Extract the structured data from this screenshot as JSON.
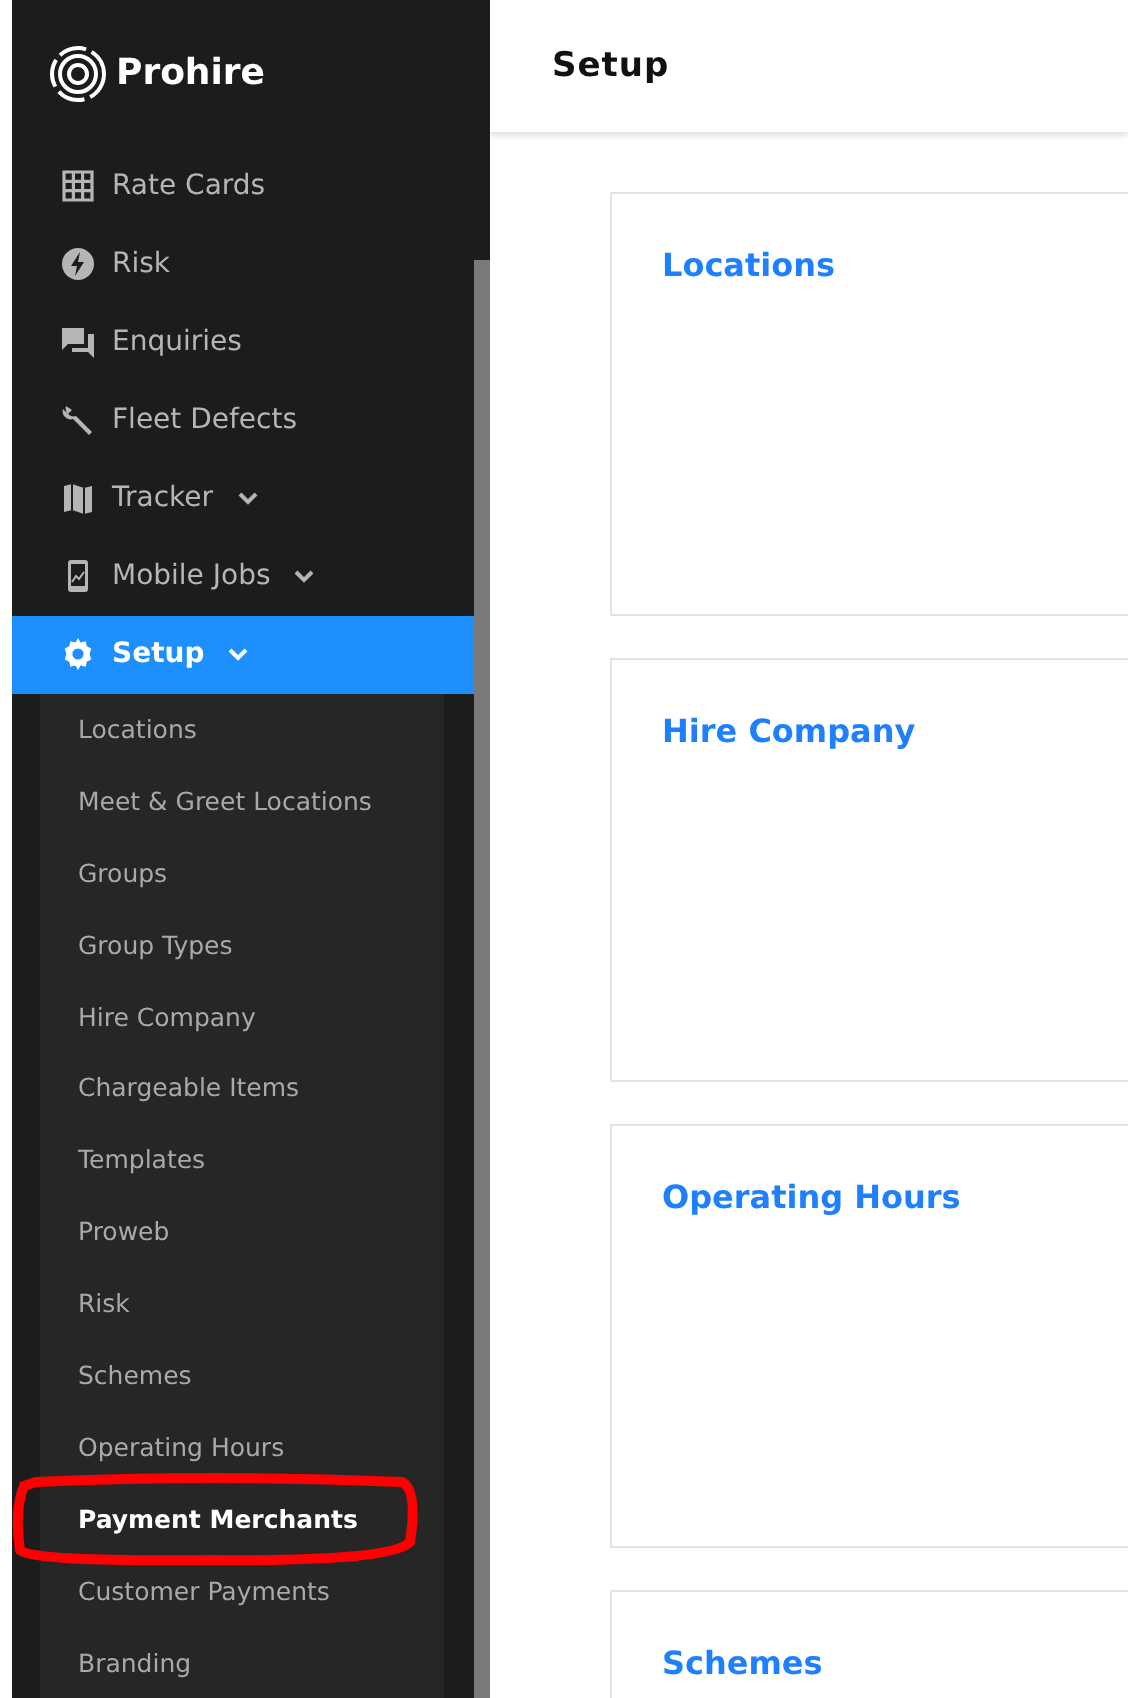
{
  "brand": {
    "name": "Prohire"
  },
  "header": {
    "title": "Setup"
  },
  "menu": [
    {
      "label": "Rate Cards",
      "expandable": false,
      "selected": false
    },
    {
      "label": "Risk",
      "expandable": false,
      "selected": false
    },
    {
      "label": "Enquiries",
      "expandable": false,
      "selected": false
    },
    {
      "label": "Fleet Defects",
      "expandable": false,
      "selected": false
    },
    {
      "label": "Tracker",
      "expandable": true,
      "selected": false
    },
    {
      "label": "Mobile Jobs",
      "expandable": true,
      "selected": false
    },
    {
      "label": "Setup",
      "expandable": true,
      "selected": true
    }
  ],
  "submenu": [
    {
      "label": "Locations",
      "selected": false,
      "circled": false
    },
    {
      "label": "Meet & Greet Locations",
      "selected": false,
      "circled": false
    },
    {
      "label": "Groups",
      "selected": false,
      "circled": false
    },
    {
      "label": "Group Types",
      "selected": false,
      "circled": false
    },
    {
      "label": "Hire Company",
      "selected": false,
      "circled": false
    },
    {
      "label": "Chargeable Items",
      "selected": false,
      "circled": false
    },
    {
      "label": "Templates",
      "selected": false,
      "circled": false
    },
    {
      "label": "Proweb",
      "selected": false,
      "circled": false
    },
    {
      "label": "Risk",
      "selected": false,
      "circled": false
    },
    {
      "label": "Schemes",
      "selected": false,
      "circled": false
    },
    {
      "label": "Operating Hours",
      "selected": false,
      "circled": false
    },
    {
      "label": "Payment Merchants",
      "selected": true,
      "circled": true
    },
    {
      "label": "Customer Payments",
      "selected": false,
      "circled": false
    },
    {
      "label": "Branding",
      "selected": false,
      "circled": false
    }
  ],
  "cards": [
    {
      "title": "Locations"
    },
    {
      "title": "Hire Company"
    },
    {
      "title": "Operating Hours"
    },
    {
      "title": "Schemes"
    }
  ]
}
